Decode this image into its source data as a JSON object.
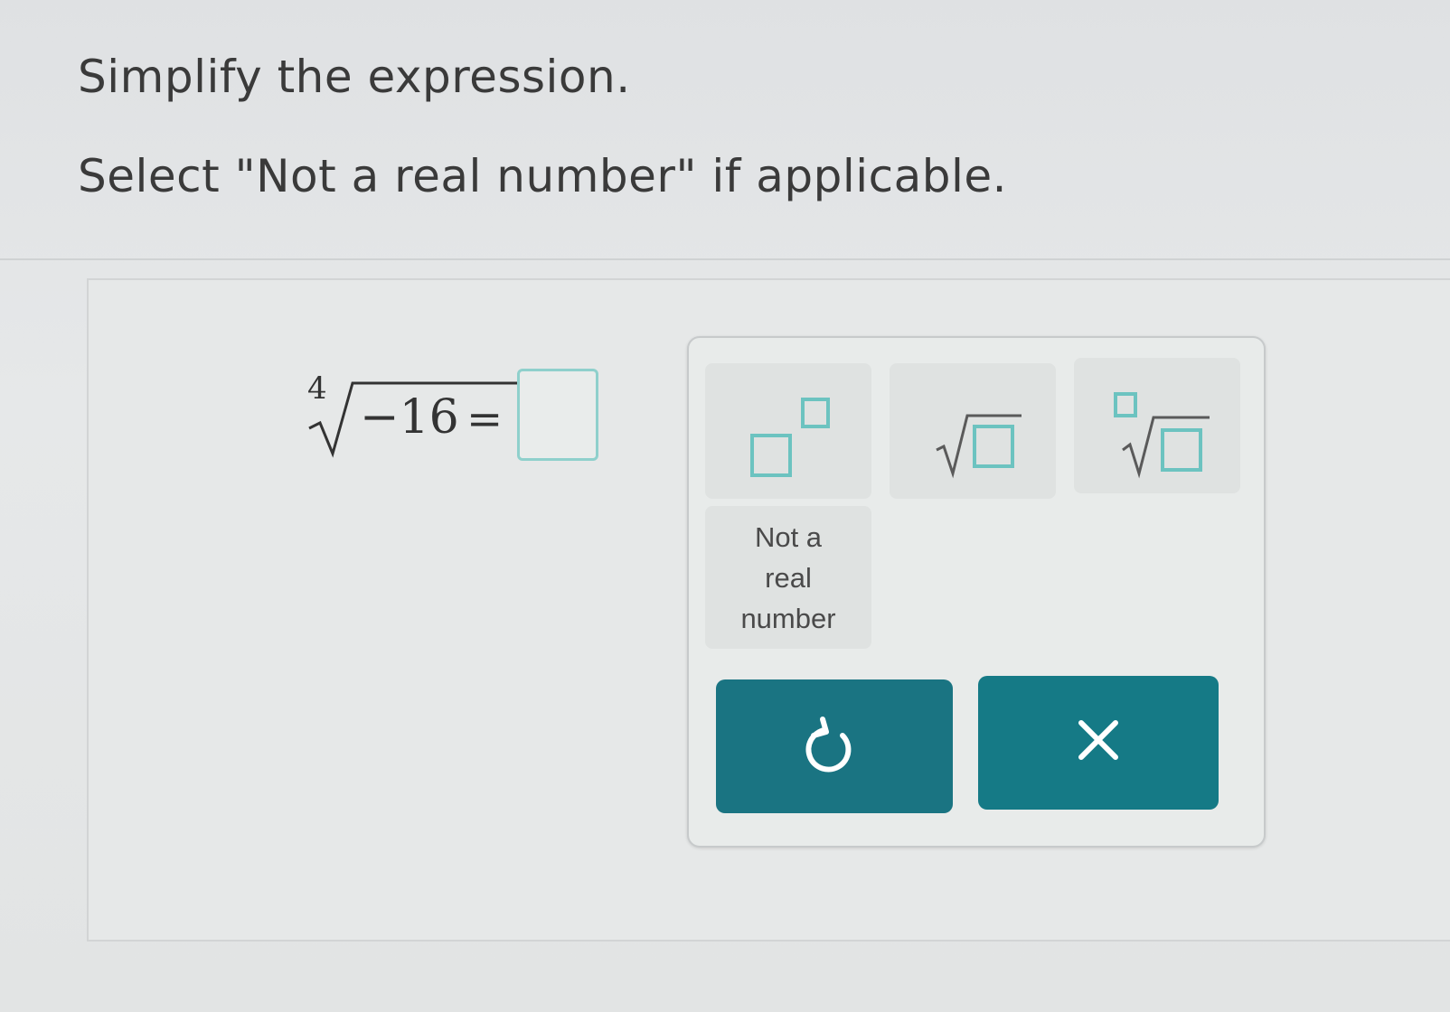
{
  "prompt": {
    "line1": "Simplify the expression.",
    "line2": "Select \"Not a real number\" if applicable."
  },
  "expression": {
    "index": "4",
    "radicand": "−16",
    "equals": "="
  },
  "keypad": {
    "keys": [
      {
        "icon": "exponent-template-icon"
      },
      {
        "icon": "square-root-template-icon"
      },
      {
        "icon": "nth-root-template-icon"
      },
      {
        "label": "Not a real number"
      }
    ],
    "actions": [
      {
        "icon": "undo-icon"
      },
      {
        "icon": "clear-x-icon"
      }
    ]
  },
  "colors": {
    "accent_teal": "#1a7482",
    "template_box": "#6cc3c0",
    "answer_box_border": "#8fd0cc"
  }
}
